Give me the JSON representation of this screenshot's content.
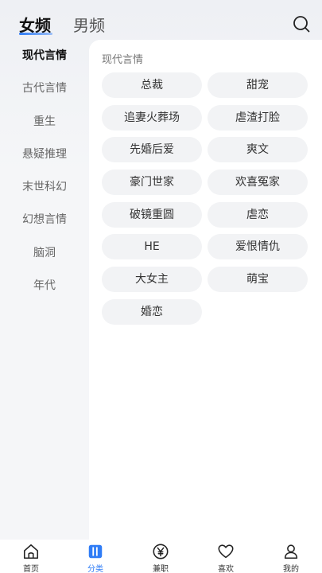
{
  "header": {
    "tabs": [
      {
        "label": "女频",
        "active": true
      },
      {
        "label": "男频",
        "active": false
      }
    ],
    "search_icon": "search-icon",
    "accent_color": "#2f7cf6"
  },
  "sidebar": {
    "items": [
      {
        "label": "现代言情",
        "active": true
      },
      {
        "label": "古代言情",
        "active": false
      },
      {
        "label": "重生",
        "active": false
      },
      {
        "label": "悬疑推理",
        "active": false
      },
      {
        "label": "末世科幻",
        "active": false
      },
      {
        "label": "幻想言情",
        "active": false
      },
      {
        "label": "脑洞",
        "active": false
      },
      {
        "label": "年代",
        "active": false
      }
    ]
  },
  "content": {
    "section_title": "现代言情",
    "tags": [
      "总裁",
      "甜宠",
      "追妻火葬场",
      "虐渣打脸",
      "先婚后爱",
      "爽文",
      "豪门世家",
      "欢喜冤家",
      "破镜重圆",
      "虐恋",
      "HE",
      "爱恨情仇",
      "大女主",
      "萌宝",
      "婚恋"
    ]
  },
  "bottom_nav": {
    "items": [
      {
        "label": "首页",
        "icon": "home-icon",
        "active": false
      },
      {
        "label": "分类",
        "icon": "category-icon",
        "active": true
      },
      {
        "label": "兼职",
        "icon": "yen-icon",
        "active": false
      },
      {
        "label": "喜欢",
        "icon": "heart-icon",
        "active": false
      },
      {
        "label": "我的",
        "icon": "user-icon",
        "active": false
      }
    ]
  }
}
